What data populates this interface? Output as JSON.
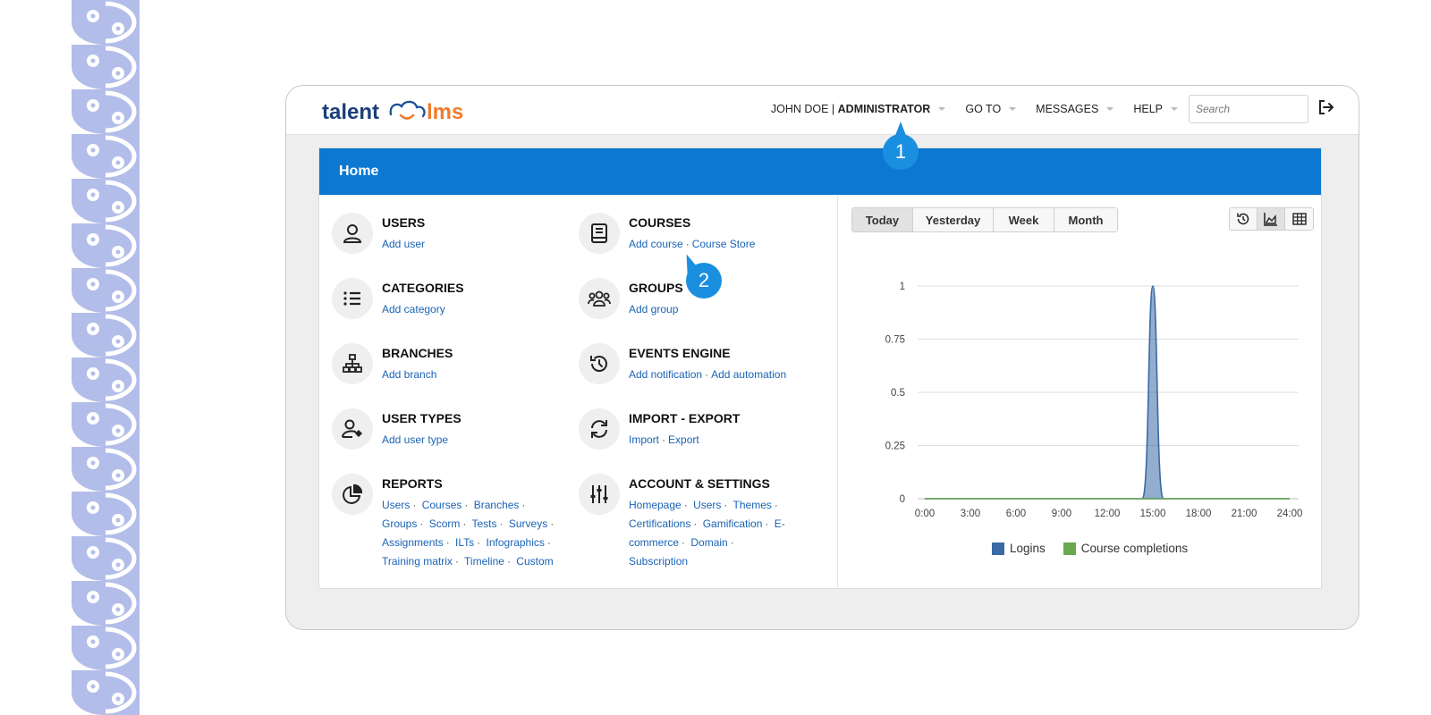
{
  "header": {
    "user_name": "JOHN DOE |",
    "user_role": "ADMINISTRATOR",
    "goto_label": "GO TO",
    "messages_label": "MESSAGES",
    "help_label": "HELP",
    "search_placeholder": "Search"
  },
  "panel": {
    "title": "Home"
  },
  "sections": {
    "users": {
      "title": "USERS",
      "links": [
        "Add user"
      ]
    },
    "courses": {
      "title": "COURSES",
      "links": [
        "Add course",
        "Course Store"
      ]
    },
    "categories": {
      "title": "CATEGORIES",
      "links": [
        "Add category"
      ]
    },
    "groups": {
      "title": "GROUPS",
      "links": [
        "Add group"
      ]
    },
    "branches": {
      "title": "BRANCHES",
      "links": [
        "Add branch"
      ]
    },
    "events": {
      "title": "EVENTS ENGINE",
      "links": [
        "Add notification",
        "Add automation"
      ]
    },
    "user_types": {
      "title": "USER TYPES",
      "links": [
        "Add user type"
      ]
    },
    "import_export": {
      "title": "IMPORT - EXPORT",
      "links": [
        "Import",
        "Export"
      ]
    },
    "reports": {
      "title": "REPORTS",
      "links": [
        "Users",
        "Courses",
        "Branches",
        "Groups",
        "Scorm",
        "Tests",
        "Surveys",
        "Assignments",
        "ILTs",
        "Infographics",
        "Training matrix",
        "Timeline",
        "Custom"
      ]
    },
    "account": {
      "title": "ACCOUNT & SETTINGS",
      "links": [
        "Homepage",
        "Users",
        "Themes",
        "Certifications",
        "Gamification",
        "E-commerce",
        "Domain",
        "Subscription"
      ]
    }
  },
  "period_tabs": [
    "Today",
    "Yesterday",
    "Week",
    "Month"
  ],
  "active_period": "Today",
  "view_buttons": [
    "history-icon",
    "area-chart-icon",
    "table-grid-icon"
  ],
  "callouts": [
    "1",
    "2"
  ],
  "colors": {
    "header_blue": "#0c78d2",
    "link_blue": "#1a63b5",
    "logins": "#3a6aa5",
    "course_completions": "#6aa84f",
    "callout": "#1a8fe0"
  },
  "chart_data": {
    "type": "area",
    "x": [
      "0:00",
      "3:00",
      "6:00",
      "9:00",
      "12:00",
      "15:00",
      "18:00",
      "21:00",
      "24:00"
    ],
    "ylim": [
      0,
      1
    ],
    "yticks": [
      "0",
      "0.25",
      "0.5",
      "0.75",
      "1"
    ],
    "grid": true,
    "legend_position": "bottom",
    "series": [
      {
        "name": "Logins",
        "values": [
          0,
          0,
          0,
          0,
          0,
          1,
          0,
          0,
          0
        ]
      },
      {
        "name": "Course completions",
        "values": [
          0,
          0,
          0,
          0,
          0,
          0,
          0,
          0,
          0
        ]
      }
    ]
  }
}
